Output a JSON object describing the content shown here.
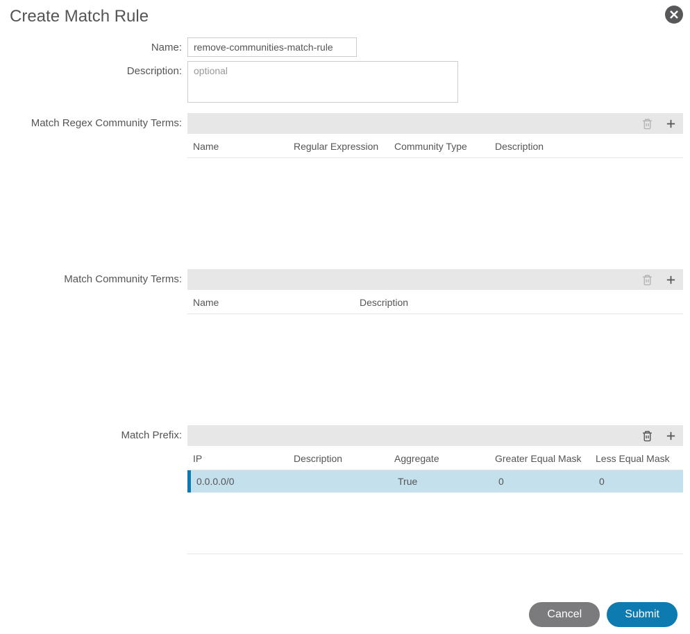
{
  "dialog": {
    "title": "Create Match Rule"
  },
  "form": {
    "name_label": "Name:",
    "name_value": "remove-communities-match-rule",
    "description_label": "Description:",
    "description_placeholder": "optional"
  },
  "sections": {
    "regex": {
      "label": "Match Regex Community Terms:",
      "columns": {
        "name": "Name",
        "regex": "Regular Expression",
        "type": "Community Type",
        "description": "Description"
      }
    },
    "community": {
      "label": "Match Community Terms:",
      "columns": {
        "name": "Name",
        "description": "Description"
      }
    },
    "prefix": {
      "label": "Match Prefix:",
      "columns": {
        "ip": "IP",
        "description": "Description",
        "aggregate": "Aggregate",
        "gem": "Greater Equal Mask",
        "lem": "Less Equal Mask"
      },
      "rows": [
        {
          "ip": "0.0.0.0/0",
          "description": "",
          "aggregate": "True",
          "gem": "0",
          "lem": "0"
        }
      ]
    }
  },
  "footer": {
    "cancel": "Cancel",
    "submit": "Submit"
  }
}
